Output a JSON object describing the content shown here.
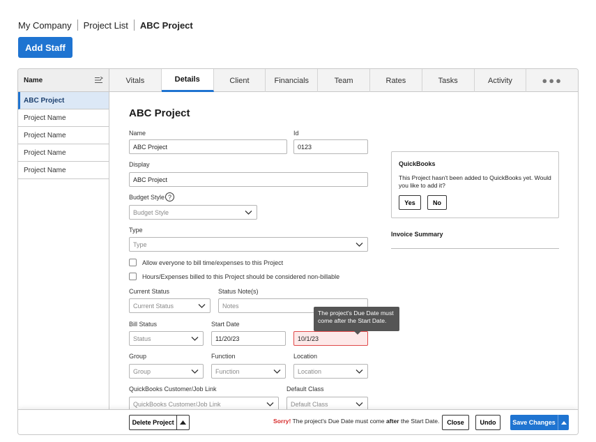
{
  "breadcrumb": {
    "company": "My Company",
    "list": "Project List",
    "current": "ABC Project"
  },
  "add_staff_label": "Add Staff",
  "project_list": {
    "header": "Name",
    "items": [
      "ABC Project",
      "Project Name",
      "Project Name",
      "Project Name",
      "Project Name"
    ]
  },
  "tabs": [
    "Vitals",
    "Details",
    "Client",
    "Financials",
    "Team",
    "Rates",
    "Tasks",
    "Activity"
  ],
  "active_tab": "Details",
  "more_tabs_glyph": "●●●",
  "form": {
    "title": "ABC Project",
    "name_label": "Name",
    "name_value": "ABC Project",
    "id_label": "Id",
    "id_value": "0123",
    "display_label": "Display",
    "display_value": "ABC Project",
    "budget_style_label": "Budget Style",
    "budget_style_placeholder": "Budget Style",
    "type_label": "Type",
    "type_placeholder": "Type",
    "checkbox_bill_all": "Allow everyone to bill time/expenses to this Project",
    "checkbox_nonbillable": "Hours/Expenses billed to this Project should be considered non-billable",
    "current_status_label": "Current Status",
    "current_status_placeholder": "Current Status",
    "status_notes_label": "Status Note(s)",
    "status_notes_placeholder": "Notes",
    "bill_status_label": "Bill Status",
    "bill_status_placeholder": "Status",
    "start_date_label": "Start Date",
    "start_date_value": "11/20/23",
    "due_date_value": "10/1/23",
    "group_label": "Group",
    "group_placeholder": "Group",
    "function_label": "Function",
    "function_placeholder": "Function",
    "location_label": "Location",
    "location_placeholder": "Location",
    "qb_link_label": "QuickBooks Customer/Job Link",
    "qb_link_placeholder": "QuickBooks Customer/Job Link",
    "default_class_label": "Default Class",
    "default_class_placeholder": "Default Class"
  },
  "tooltip": {
    "text": "The project's Due Date must come after the Start Date."
  },
  "quickbooks": {
    "title": "QuickBooks",
    "message": "This Project hasn't been added to QuickBooks yet. Would you like to add it?",
    "yes_label": "Yes",
    "no_label": "No"
  },
  "invoice_summary_label": "Invoice Summary",
  "footer": {
    "delete_label": "Delete Project",
    "error_sorry": "Sorry!",
    "error_part1": " The project's Due Date must come ",
    "error_bold": "after",
    "error_part2": " the Start Date.",
    "close_label": "Close",
    "undo_label": "Undo",
    "save_label": "Save Changes"
  },
  "colors": {
    "primary": "#1f74d1",
    "error": "#d62828",
    "error_bg": "#fde9e9"
  }
}
